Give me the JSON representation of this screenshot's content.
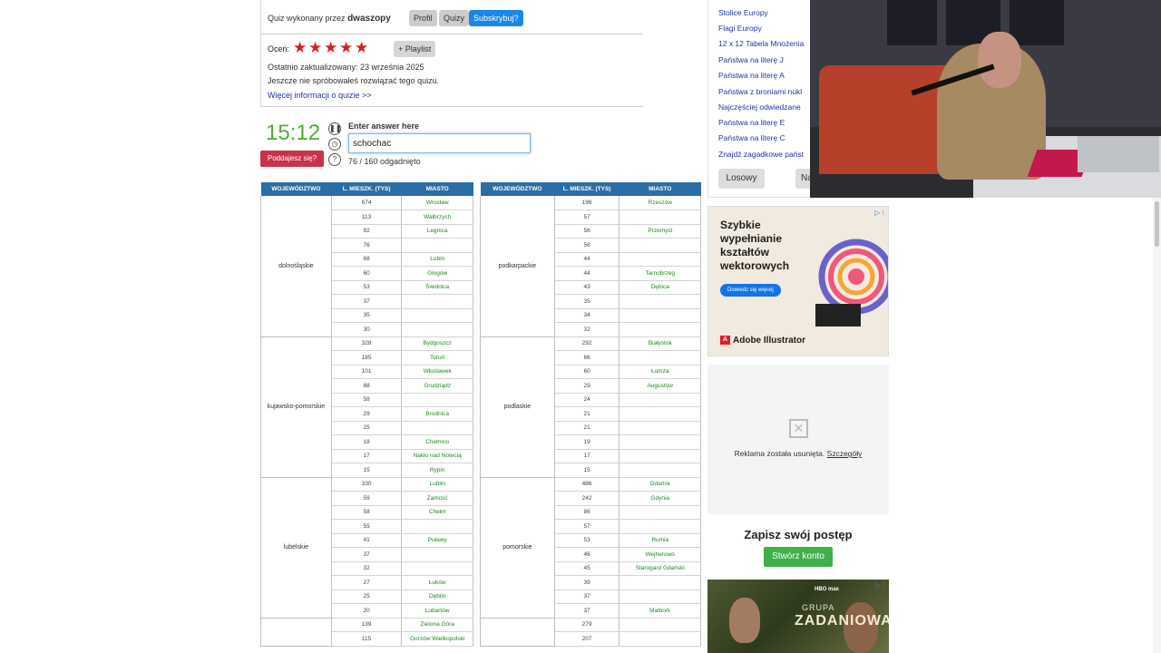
{
  "quiz": {
    "by_prefix": "Quiz wykonany przez",
    "author": "dwaszopy",
    "btn_profile": "Profil",
    "btn_quizzes": "Quizy",
    "btn_subscribe": "Subskrybuj?",
    "rate_label": "Oceń:",
    "stars": 5,
    "playlist": "+ Playlist",
    "updated": "Ostatnio zaktualizowany: 23 września 2025",
    "not_tried": "Jeszcze nie spróbowałeś rozwiązać tego quizu.",
    "more_info": "Więcej informacji o quizie >>"
  },
  "game": {
    "timer": "15:12",
    "give_up": "Poddajesz się?",
    "enter_label": "Enter answer here",
    "answer_value": "schochac",
    "progress": "76 / 160 odgadnięto"
  },
  "table": {
    "headers": [
      "WOJEWÓDZTWO",
      "L. MIESZK. (TYS)",
      "MIASTO"
    ],
    "left": [
      {
        "woj": "dolnośląskie",
        "rows": [
          [
            "674",
            "Wrocław"
          ],
          [
            "113",
            "Wałbrzych"
          ],
          [
            "92",
            "Legnica"
          ],
          [
            "76",
            ""
          ],
          [
            "68",
            "Lubin"
          ],
          [
            "60",
            "Głogów"
          ],
          [
            "53",
            "Świdnica"
          ],
          [
            "37",
            ""
          ],
          [
            "35",
            ""
          ],
          [
            "30",
            ""
          ]
        ]
      },
      {
        "woj": "kujawsko-pomorskie",
        "rows": [
          [
            "328",
            "Bydgoszcz"
          ],
          [
            "185",
            "Toruń"
          ],
          [
            "101",
            "Włocławek"
          ],
          [
            "88",
            "Grudziądz"
          ],
          [
            "58",
            ""
          ],
          [
            "29",
            "Brodnica"
          ],
          [
            "25",
            ""
          ],
          [
            "18",
            "Chełmno"
          ],
          [
            "17",
            "Nakło nad Notecią"
          ],
          [
            "15",
            "Rypin"
          ]
        ]
      },
      {
        "woj": "lubelskie",
        "rows": [
          [
            "330",
            "Lublin"
          ],
          [
            "59",
            "Zamość"
          ],
          [
            "58",
            "Chełm"
          ],
          [
            "55",
            ""
          ],
          [
            "41",
            "Puławy"
          ],
          [
            "37",
            ""
          ],
          [
            "32",
            ""
          ],
          [
            "27",
            "Łuków"
          ],
          [
            "25",
            "Dęblin"
          ],
          [
            "20",
            "Lubartów"
          ]
        ]
      },
      {
        "woj": "",
        "rows": [
          [
            "139",
            "Zielona Góra"
          ],
          [
            "115",
            "Gorzów Wielkopolski"
          ]
        ]
      }
    ],
    "right": [
      {
        "woj": "podkarpackie",
        "rows": [
          [
            "196",
            "Rzeszów"
          ],
          [
            "57",
            ""
          ],
          [
            "56",
            "Przemyśl"
          ],
          [
            "56",
            ""
          ],
          [
            "44",
            ""
          ],
          [
            "44",
            "Tarnobrzeg"
          ],
          [
            "43",
            "Dębica"
          ],
          [
            "35",
            ""
          ],
          [
            "34",
            ""
          ],
          [
            "32",
            ""
          ]
        ]
      },
      {
        "woj": "podlaskie",
        "rows": [
          [
            "292",
            "Białystok"
          ],
          [
            "66",
            ""
          ],
          [
            "60",
            "Łomża"
          ],
          [
            "29",
            "Augustów"
          ],
          [
            "24",
            ""
          ],
          [
            "21",
            ""
          ],
          [
            "21",
            ""
          ],
          [
            "19",
            ""
          ],
          [
            "17",
            ""
          ],
          [
            "15",
            ""
          ]
        ]
      },
      {
        "woj": "pomorskie",
        "rows": [
          [
            "486",
            "Gdańsk"
          ],
          [
            "242",
            "Gdynia"
          ],
          [
            "86",
            ""
          ],
          [
            "57",
            ""
          ],
          [
            "53",
            "Rumia"
          ],
          [
            "46",
            "Wejherowo"
          ],
          [
            "45",
            "Starogard Gdański"
          ],
          [
            "39",
            ""
          ],
          [
            "37",
            ""
          ],
          [
            "37",
            "Malbork"
          ]
        ]
      },
      {
        "woj": "",
        "rows": [
          [
            "279",
            ""
          ],
          [
            "207",
            ""
          ]
        ]
      }
    ]
  },
  "sidebar": {
    "links": [
      "Stolice Europy",
      "Flagi Europy",
      "12 x 12 Tabela Mnożenia",
      "Państwa na literę J",
      "Państwa na literę A",
      "Państwa z broniami nukl",
      "Najczęściej odwiedzane",
      "Państwa na literę E",
      "Państwa na literę C",
      "Znajdź zagadkowe państ"
    ],
    "btn_random": "Losowy",
    "btn_next": "Na",
    "ad1_headline": "Szybkie wypełnianie kształtów wektorowych",
    "ad1_cta": "Dowiedz się więcej",
    "ad1_brand": "Adobe Illustrator",
    "ad_removed": "Reklama została usunięta.",
    "ad_removed_link": "Szczegóły",
    "save_title": "Zapisz swój postęp",
    "create_account": "Stwórz konto",
    "ad2_line1": "HBO max",
    "ad2_line2": "GRUPA",
    "ad2_line3": "ZADANIOWA"
  },
  "colors": {
    "timer": "#4caf2e",
    "header": "#2b6ea6",
    "city": "#1f8a1f",
    "give_up": "#c8324b",
    "subscribe": "#1a86e8",
    "create": "#3fb049"
  }
}
